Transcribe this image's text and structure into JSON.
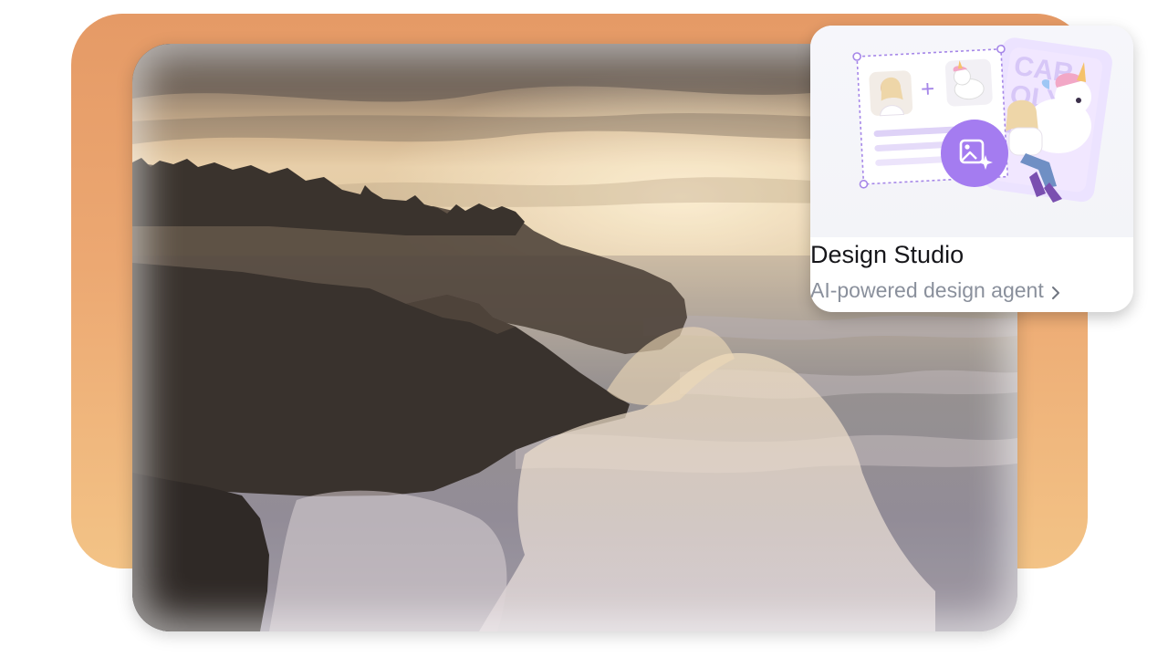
{
  "card": {
    "title": "Design Studio",
    "subtitle": "AI-powered design agent",
    "chevron_icon": "chevron-right-icon",
    "feature_icon": "image-sparkle-icon",
    "accent": "#a47cf0"
  },
  "colors": {
    "backdrop_top": "#e59a66",
    "backdrop_bottom": "#f3c386",
    "title_text": "#16161a",
    "subtitle_text": "#8a909c"
  }
}
